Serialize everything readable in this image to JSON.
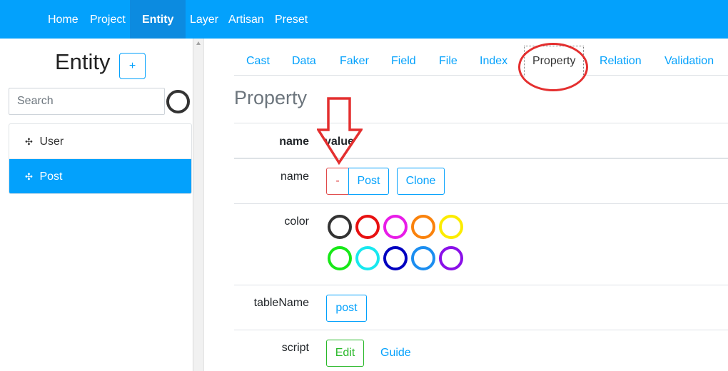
{
  "nav": {
    "items": [
      {
        "label": "Home",
        "active": false
      },
      {
        "label": "Project",
        "active": false
      },
      {
        "label": "Entity",
        "active": true
      },
      {
        "label": "Layer",
        "active": false
      },
      {
        "label": "Artisan",
        "active": false
      },
      {
        "label": "Preset",
        "active": false
      }
    ]
  },
  "sidebar": {
    "title": "Entity",
    "add_label": "+",
    "search_placeholder": "Search",
    "items": [
      {
        "label": "User",
        "active": false
      },
      {
        "label": "Post",
        "active": true
      }
    ]
  },
  "tabs": [
    {
      "label": "Cast"
    },
    {
      "label": "Data"
    },
    {
      "label": "Faker"
    },
    {
      "label": "Field"
    },
    {
      "label": "File"
    },
    {
      "label": "Index"
    },
    {
      "label": "Property",
      "active": true
    },
    {
      "label": "Relation"
    },
    {
      "label": "Validation"
    }
  ],
  "main": {
    "title": "Property",
    "header": {
      "name": "name",
      "value": "value"
    },
    "rows": {
      "name": {
        "key": "name",
        "remove_label": "-",
        "value_label": "Post",
        "clone_label": "Clone"
      },
      "color": {
        "key": "color"
      },
      "tableName": {
        "key": "tableName",
        "value_label": "post"
      },
      "script": {
        "key": "script",
        "edit_label": "Edit",
        "guide_label": "Guide"
      }
    },
    "colors": [
      "#333333",
      "#e81010",
      "#e81ce8",
      "#fa820c",
      "#fcec00",
      "#18e818",
      "#18e8ef",
      "#0000c0",
      "#1c8ef0",
      "#8a10e8"
    ]
  },
  "annotation_color": "#e42f2f"
}
